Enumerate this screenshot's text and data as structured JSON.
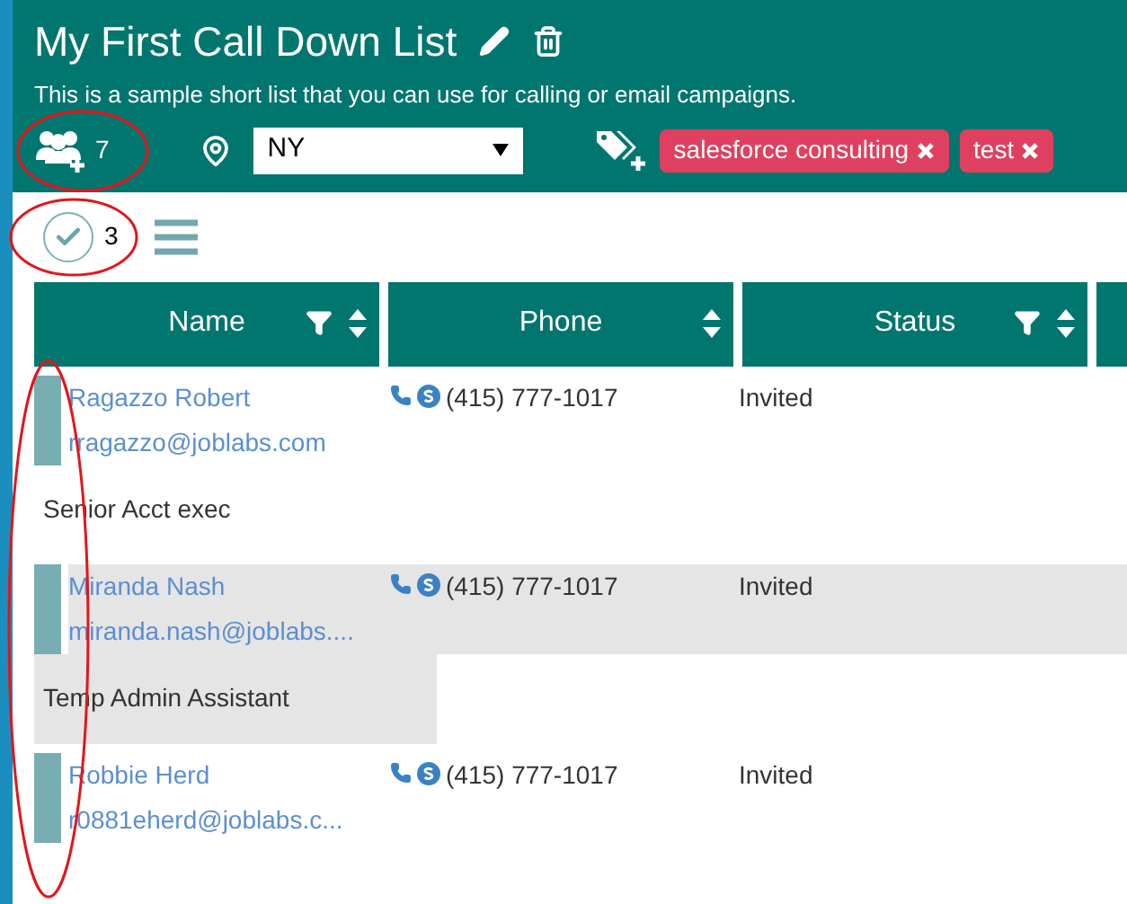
{
  "list": {
    "title": "My First Call Down List",
    "description": "This is a sample short list that you can use for calling or email campaigns."
  },
  "toolbar": {
    "contacts_count": "7",
    "location": "NY",
    "tags": [
      {
        "label": "salesforce consulting"
      },
      {
        "label": "test"
      }
    ]
  },
  "selection": {
    "checked": true,
    "count": "3"
  },
  "table": {
    "columns": [
      {
        "label": "Name",
        "filter": true
      },
      {
        "label": "Phone",
        "filter": false
      },
      {
        "label": "Status",
        "filter": true
      }
    ],
    "rows": [
      {
        "name": "Ragazzo Robert",
        "email": "rragazzo@joblabs.com",
        "title": "Senior Acct exec",
        "phone": "(415) 777-1017",
        "status": "Invited",
        "selected": false
      },
      {
        "name": "Miranda Nash",
        "email": "miranda.nash@joblabs....",
        "title": "Temp Admin Assistant",
        "phone": "(415) 777-1017",
        "status": "Invited",
        "selected": true
      },
      {
        "name": "Robbie Herd",
        "email": "r0881eherd@joblabs.c...",
        "phone": "(415) 777-1017",
        "status": "Invited",
        "selected": false
      }
    ]
  }
}
